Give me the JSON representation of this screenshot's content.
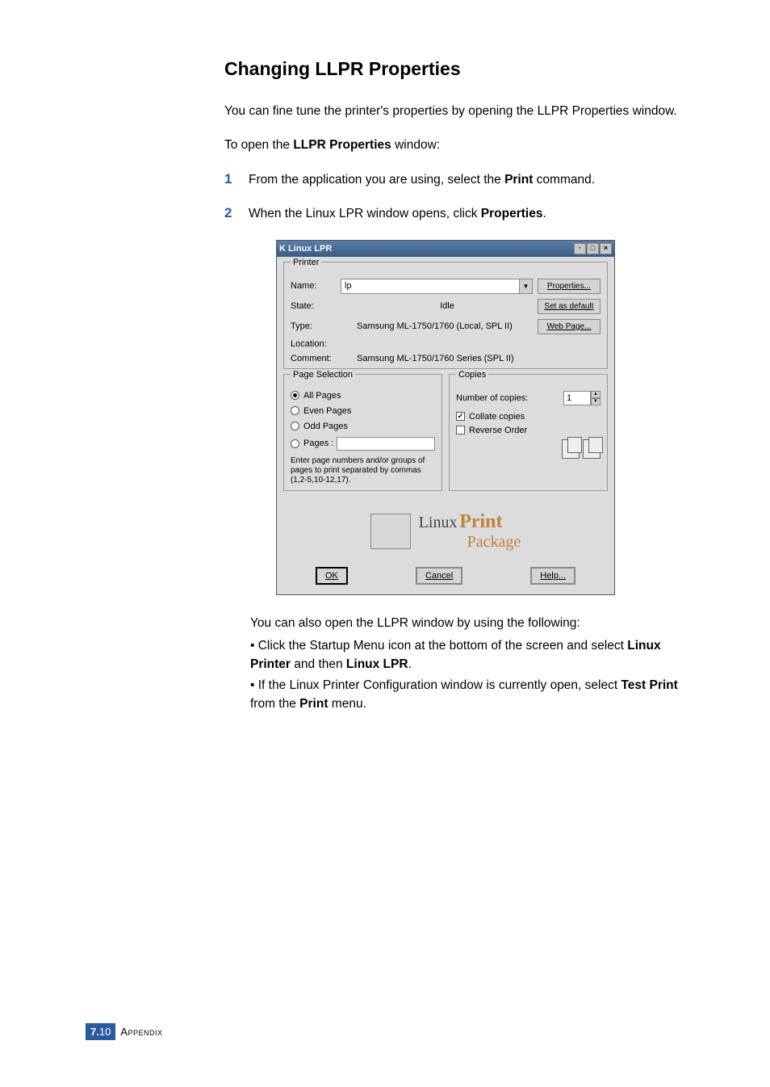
{
  "heading": "Changing LLPR Properties",
  "intro": "You can fine tune the printer's properties by opening the LLPR Properties window.",
  "opener": {
    "pre": "To open the ",
    "bold": "LLPR Properties",
    "post": " window:"
  },
  "steps": {
    "s1": {
      "num": "1",
      "pre": "From the application you are using, select the ",
      "bold": "Print",
      "post": " command."
    },
    "s2": {
      "num": "2",
      "pre": "When the Linux LPR window opens, click ",
      "bold": "Properties",
      "post": "."
    }
  },
  "after": "You can also open the LLPR window by using the following:",
  "bullets": {
    "b1": {
      "pre": "Click the Startup Menu icon at the bottom of the screen and select ",
      "b1": "Linux Printer",
      "mid": " and then ",
      "b2": "Linux LPR",
      "post": "."
    },
    "b2": {
      "pre": "If the Linux Printer Configuration window is currently open, select ",
      "b1": "Test Print",
      "mid": " from the ",
      "b2": "Print",
      "post": " menu."
    }
  },
  "dlg": {
    "titleK": "K",
    "title": "Linux LPR",
    "printer": {
      "legend": "Printer",
      "name_lbl": "Name:",
      "name_val": "lp",
      "state_lbl": "State:",
      "state_val": "Idle",
      "type_lbl": "Type:",
      "type_val": "Samsung ML-1750/1760 (Local, SPL II)",
      "loc_lbl": "Location:",
      "loc_val": "",
      "comm_lbl": "Comment:",
      "comm_val": "Samsung ML-1750/1760 Series (SPL II)",
      "btn_props": "Properties...",
      "btn_default": "Set as default",
      "btn_web": "Web Page..."
    },
    "pagesel": {
      "legend": "Page Selection",
      "all": "All Pages",
      "even": "Even Pages",
      "odd": "Odd Pages",
      "pages": "Pages :",
      "hint": "Enter page numbers and/or groups of pages to print separated by commas (1,2-5,10-12,17)."
    },
    "copies": {
      "legend": "Copies",
      "num_lbl": "Number of copies:",
      "num_val": "1",
      "collate": "Collate copies",
      "reverse": "Reverse Order"
    },
    "logo": {
      "linux": "Linux",
      "print": "Print",
      "pkg": "Package"
    },
    "btns": {
      "ok": "OK",
      "cancel": "Cancel",
      "help": "Help..."
    }
  },
  "footer": {
    "chapter": "7.",
    "page": "10",
    "section": "Appendix"
  }
}
